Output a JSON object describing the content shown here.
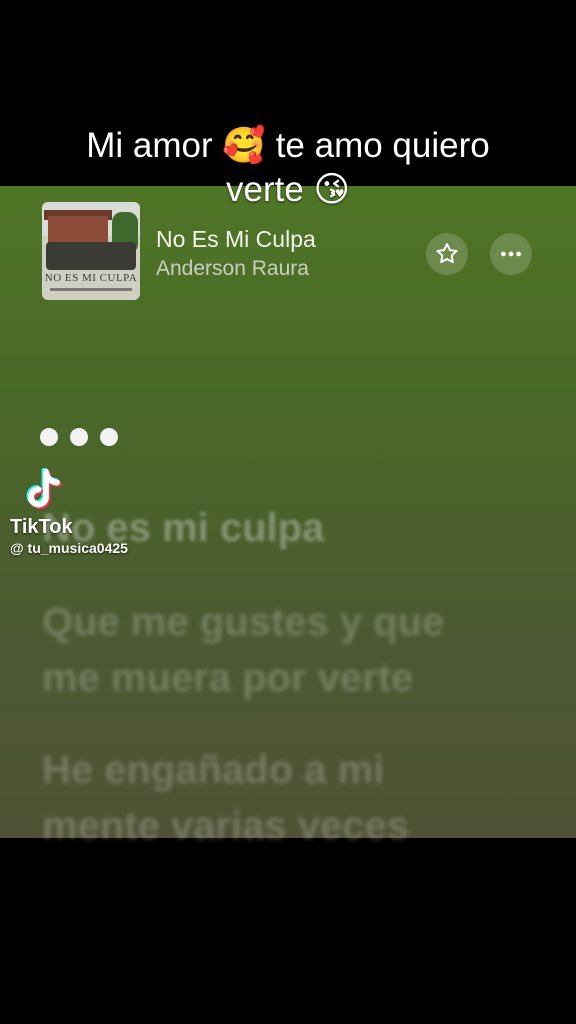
{
  "caption": {
    "line1": "Mi amor 🥰 te amo quiero",
    "line2": "verte 😘"
  },
  "now_playing": {
    "title": "No Es Mi Culpa",
    "artist": "Anderson Raura",
    "album_art_text": "NO ES MI CULPA",
    "favorite_icon": "star-icon",
    "more_icon": "more-horizontal-icon"
  },
  "lyrics": {
    "line1": "No es mi culpa",
    "line2a": "Que me gustes y que",
    "line2b": "me muera por verte",
    "line3a": "He engañado a mi",
    "line3b": "mente varias veces"
  },
  "watermark": {
    "brand": "TikTok",
    "username": "@ tu_musica0425"
  },
  "colors": {
    "background_top": "#4f7526",
    "background_bottom": "#4f5235",
    "tiktok_cyan": "#25f4ee",
    "tiktok_red": "#fe2c55"
  }
}
